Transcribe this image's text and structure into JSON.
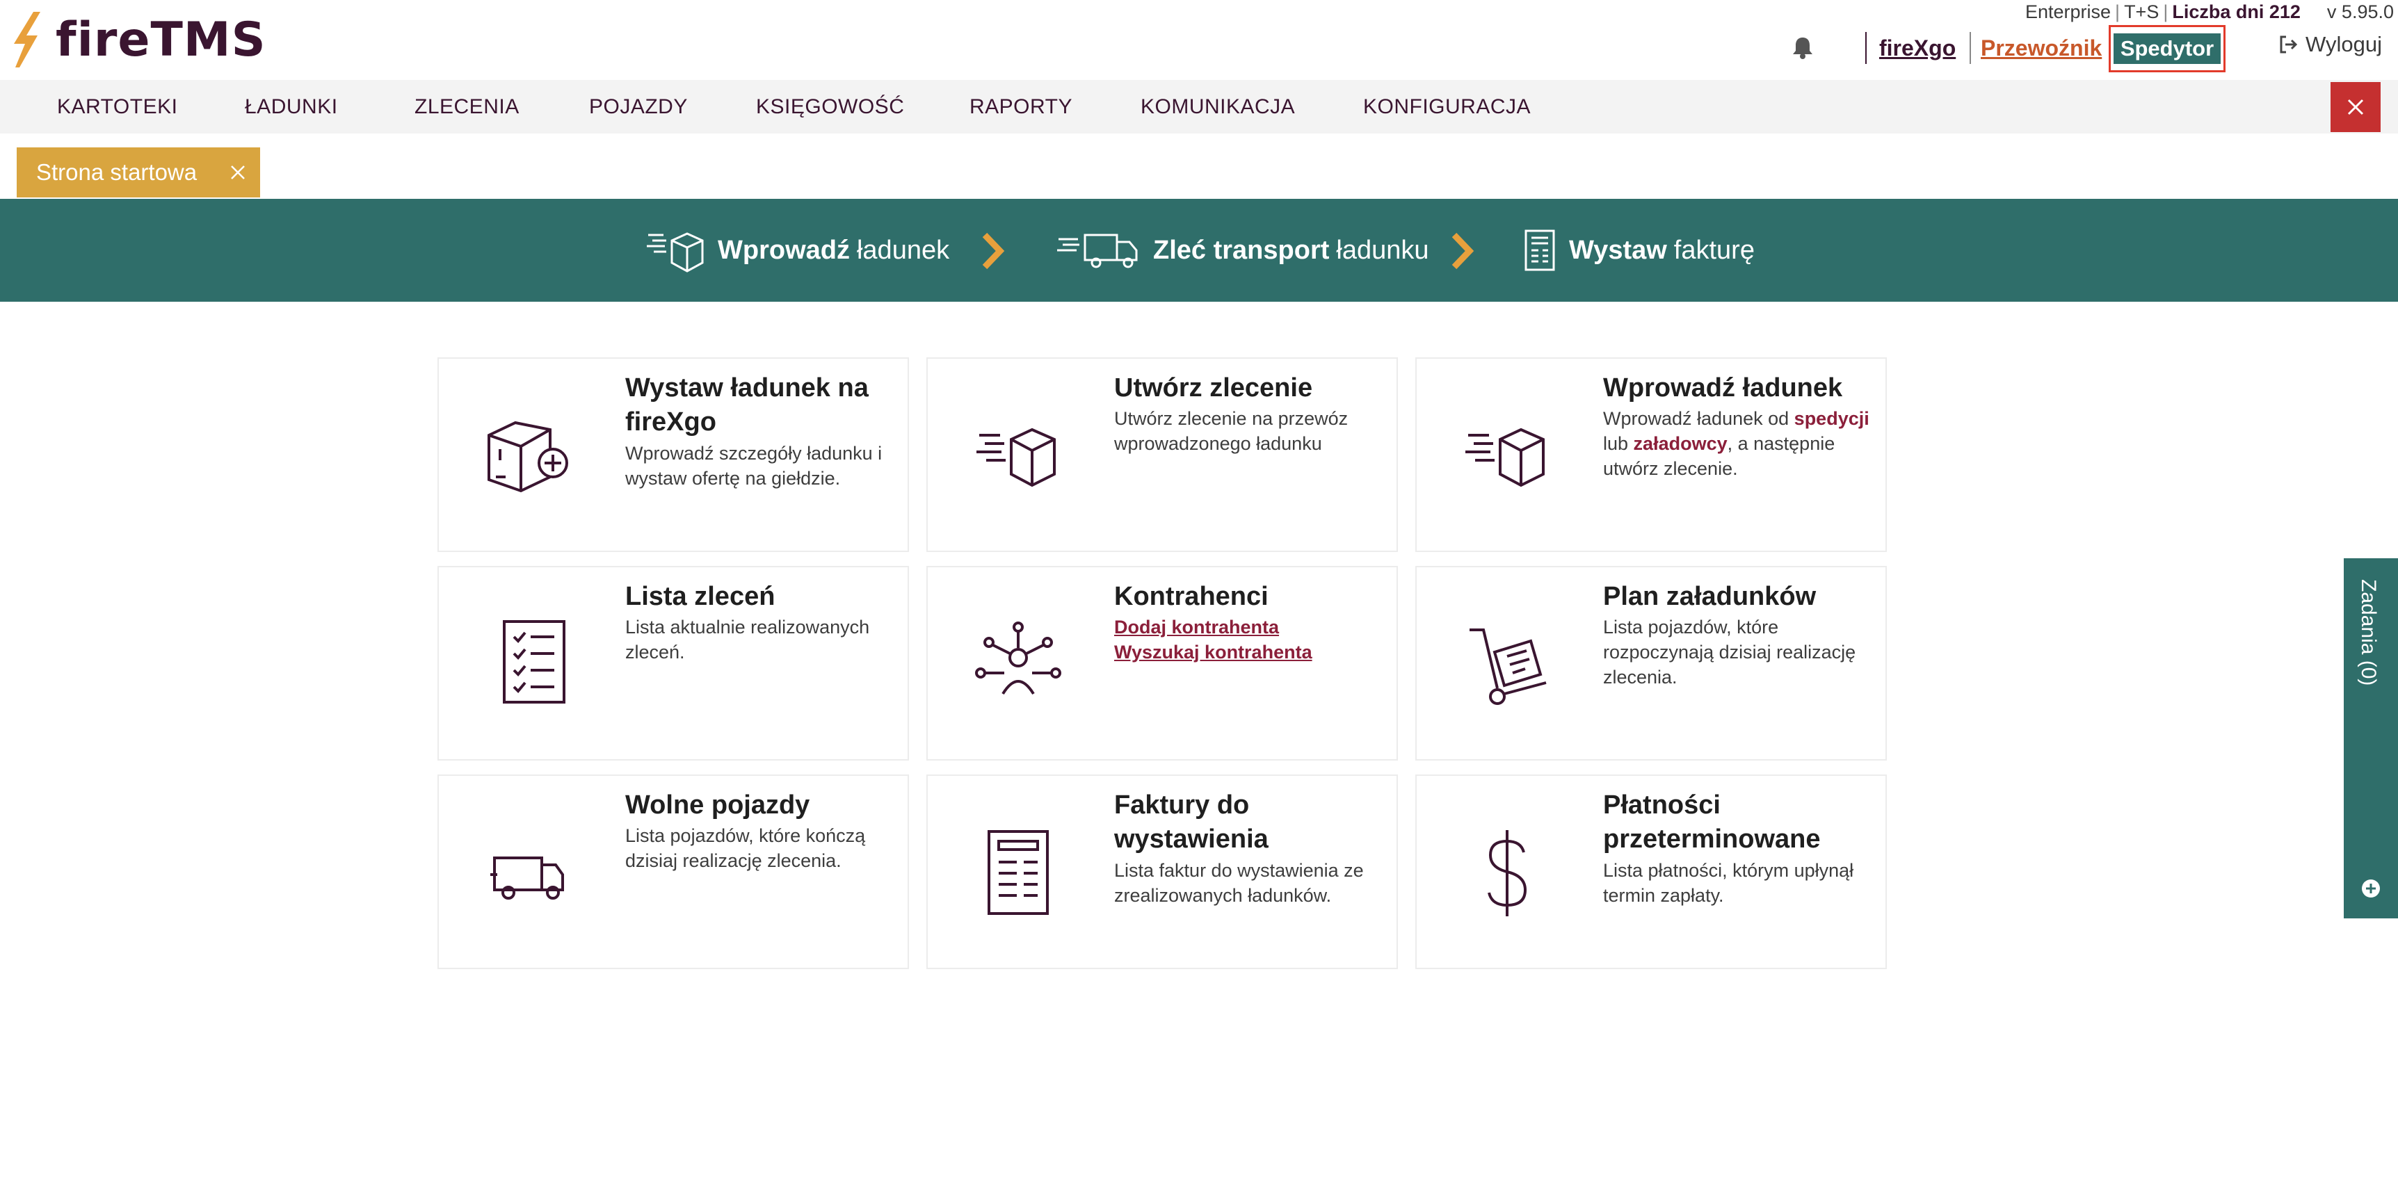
{
  "app": {
    "logo_text": "fireTMS"
  },
  "header": {
    "edition": "Enterprise",
    "plan": "T+S",
    "days_label": "Liczba dni 212",
    "version": "v 5.95.0",
    "link_firexgo": "fireXgo",
    "link_przewoznik": "Przewoźnik",
    "link_spedytor": "Spedytor",
    "logout_label": "Wyloguj"
  },
  "nav": {
    "items": [
      "KARTOTEKI",
      "ŁADUNKI",
      "ZLECENIA",
      "POJAZDY",
      "KSIĘGOWOŚĆ",
      "RAPORTY",
      "KOMUNIKACJA",
      "KONFIGURACJA"
    ]
  },
  "tabs": [
    {
      "label": "Strona startowa"
    }
  ],
  "workflow": {
    "step1_bold": "Wprowadź",
    "step1_rest": "ładunek",
    "step2_bold": "Zleć transport",
    "step2_rest": "ładunku",
    "step3_bold": "Wystaw",
    "step3_rest": "fakturę"
  },
  "cards": [
    {
      "title": "Wystaw ładunek na fireXgo",
      "desc": "Wprowadź szczegóły ładunku i wystaw ofertę na giełdzie.",
      "icon": "box-plus-icon"
    },
    {
      "title": "Utwórz zlecenie",
      "desc": "Utwórz zlecenie na przewóz wprowadzonego ładunku",
      "icon": "moving-box-icon"
    },
    {
      "title": "Wprowadź ładunek",
      "desc_a": "Wprowadź ładunek od",
      "desc_hl1": "spedycji",
      "desc_b": "lub",
      "desc_hl2": "załadowcy",
      "desc_c": ", a następnie utwórz zlecenie.",
      "icon": "moving-box-icon"
    },
    {
      "title": "Lista zleceń",
      "desc": "Lista aktualnie realizowanych zleceń.",
      "icon": "checklist-icon"
    },
    {
      "title": "Kontrahenci",
      "link1": "Dodaj kontrahenta",
      "link2": "Wyszukaj kontrahenta",
      "icon": "network-person-icon"
    },
    {
      "title": "Plan załadunków",
      "desc": "Lista pojazdów, które rozpoczynają dzisiaj realizację zlecenia.",
      "icon": "hand-truck-icon"
    },
    {
      "title": "Wolne pojazdy",
      "desc": "Lista pojazdów, które kończą dzisiaj realizację zlecenia.",
      "icon": "truck-icon"
    },
    {
      "title": "Faktury do wystawienia",
      "desc": "Lista faktur do wystawienia ze zrealizowanych ładunków.",
      "icon": "invoice-icon"
    },
    {
      "title": "Płatności przeterminowane",
      "desc": "Lista płatności, którym upłynął termin zapłaty.",
      "icon": "dollar-icon"
    }
  ],
  "side_panel": {
    "label": "Zadania (0)"
  },
  "colors": {
    "teal": "#2f6e6a",
    "plum": "#3a1530",
    "gold": "#d9a53f",
    "red": "#c53030",
    "orange": "#e8a03c"
  }
}
